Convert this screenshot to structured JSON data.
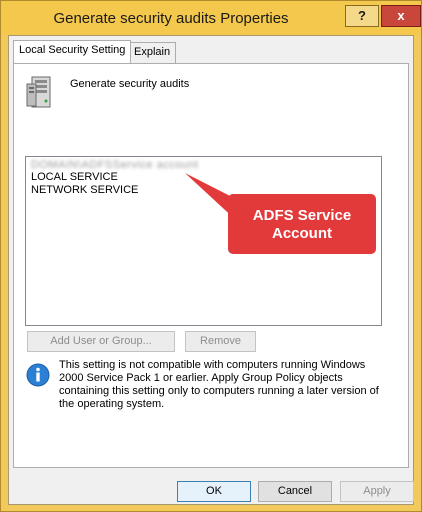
{
  "window": {
    "title": "Generate security audits Properties",
    "help_label": "?",
    "close_label": "x"
  },
  "tabs": [
    {
      "label": "Local Security Setting",
      "active": true
    },
    {
      "label": "Explain",
      "active": false
    }
  ],
  "policy": {
    "name": "Generate security audits",
    "icon": "server-icon"
  },
  "accounts": {
    "redacted_entry": "DOMAIN\\ADFSService account",
    "items": [
      "LOCAL SERVICE",
      "NETWORK SERVICE"
    ]
  },
  "buttons": {
    "add": "Add User or Group...",
    "remove": "Remove",
    "ok": "OK",
    "cancel": "Cancel",
    "apply": "Apply"
  },
  "info": {
    "icon": "info-icon",
    "text": "This setting is not compatible with computers running Windows 2000 Service Pack 1 or earlier.  Apply Group Policy objects containing this setting only to computers running a later version of the operating system."
  },
  "annotation": {
    "text_line1": "ADFS Service",
    "text_line2": "Account",
    "color": "#e23a3a"
  },
  "colors": {
    "titlebar": "#f4c84d",
    "close_button": "#c9473a"
  }
}
